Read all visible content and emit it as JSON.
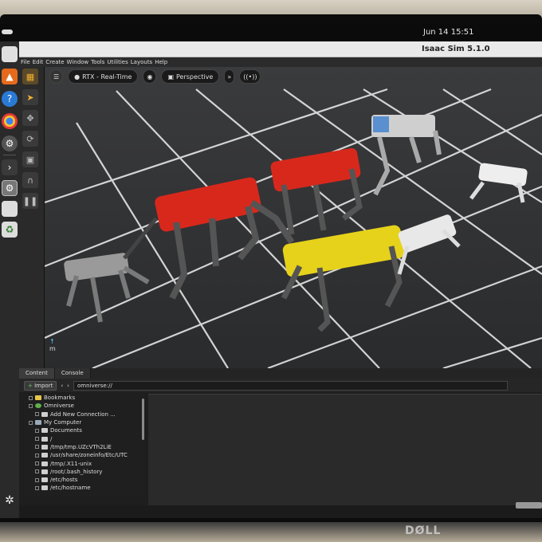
{
  "os": {
    "clock": "Jun 14  15:51"
  },
  "app": {
    "title": "Isaac Sim 5.1.0",
    "menu": [
      "File",
      "Edit",
      "Create",
      "Window",
      "Tools",
      "Utilities",
      "Layouts",
      "Help"
    ]
  },
  "viewport": {
    "render_mode": "RTX - Real-Time",
    "camera": "Perspective",
    "axis_label": "m"
  },
  "content_panel": {
    "tabs": [
      "Content",
      "Console"
    ],
    "import_label": "Import",
    "path": "omniverse://",
    "tree": [
      {
        "label": "Bookmarks",
        "icon": "bookmark-icon",
        "level": 0
      },
      {
        "label": "Omniverse",
        "icon": "omniverse-icon",
        "level": 0
      },
      {
        "label": "Add New Connection ...",
        "icon": "add-connection-icon",
        "level": 1
      },
      {
        "label": "My Computer",
        "icon": "computer-icon",
        "level": 0
      },
      {
        "label": "Documents",
        "icon": "folder-icon",
        "level": 1
      },
      {
        "label": "/",
        "icon": "folder-icon",
        "level": 1
      },
      {
        "label": "/tmp/tmp.UZcVTh2LiE",
        "icon": "folder-icon",
        "level": 1
      },
      {
        "label": "/usr/share/zoneinfo/Etc/UTC",
        "icon": "folder-icon",
        "level": 1
      },
      {
        "label": "/tmp/.X11-unix",
        "icon": "folder-icon",
        "level": 1
      },
      {
        "label": "/root/.bash_history",
        "icon": "folder-icon",
        "level": 1
      },
      {
        "label": "/etc/hosts",
        "icon": "folder-icon",
        "level": 1
      },
      {
        "label": "/etc/hostname",
        "icon": "folder-icon",
        "level": 1
      }
    ]
  },
  "monitor": {
    "brand": "DØLL"
  },
  "colors": {
    "robot_red": "#d8281c",
    "robot_yellow": "#e6d21a",
    "robot_gray": "#9a9a9a",
    "robot_white": "#e8e8e8"
  }
}
